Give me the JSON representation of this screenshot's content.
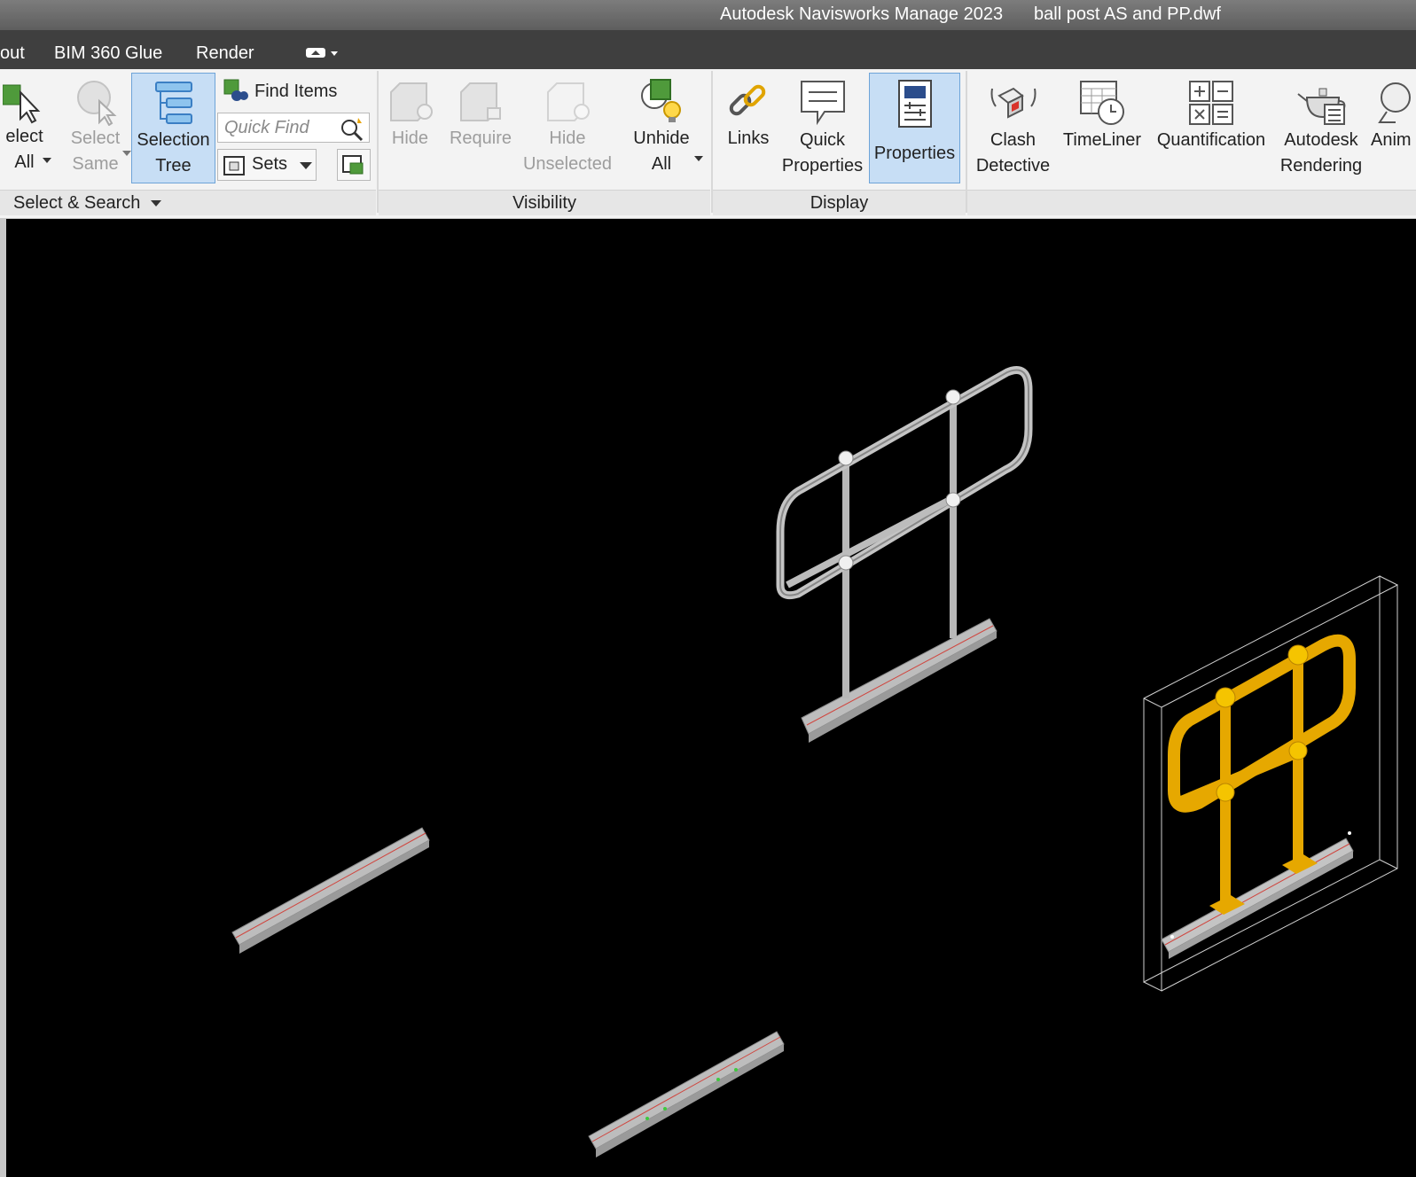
{
  "window": {
    "app_title": "Autodesk Navisworks Manage 2023",
    "file_name": "ball post AS and PP.dwf"
  },
  "menu_tabs": [
    {
      "label": "out"
    },
    {
      "label": "BIM 360 Glue"
    },
    {
      "label": "Render"
    }
  ],
  "ribbon": {
    "select_search": {
      "footer": "Select & Search",
      "select_all": {
        "line1": "elect",
        "line2": "All"
      },
      "select_same": {
        "line1": "Select",
        "line2": "Same"
      },
      "selection_tree": {
        "line1": "Selection",
        "line2": "Tree"
      },
      "find_items": "Find Items",
      "quick_find_placeholder": "Quick Find",
      "sets": "Sets"
    },
    "visibility": {
      "footer": "Visibility",
      "hide": "Hide",
      "require": "Require",
      "hide_unselected": {
        "line1": "Hide",
        "line2": "Unselected"
      },
      "unhide_all": {
        "line1": "Unhide",
        "line2": "All"
      }
    },
    "display": {
      "footer": "Display",
      "links": "Links",
      "quick_properties": {
        "line1": "Quick",
        "line2": "Properties"
      },
      "properties": "Properties"
    },
    "tools": {
      "clash_detective": {
        "line1": "Clash",
        "line2": "Detective"
      },
      "timeliner": "TimeLiner",
      "quantification": "Quantification",
      "autodesk_rendering": {
        "line1": "Autodesk",
        "line2": "Rendering"
      },
      "animator": "Anim"
    }
  },
  "colors": {
    "viewport_background": "#000000",
    "selected_highlight": "#e6a800",
    "active_button": "#c7def5",
    "model_gray": "#b5b5b5"
  }
}
